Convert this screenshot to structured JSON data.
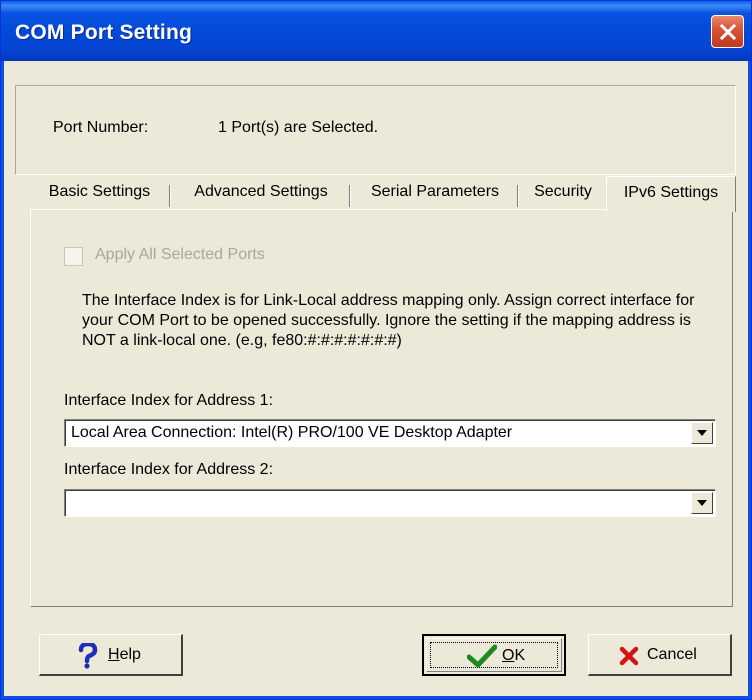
{
  "window": {
    "title": "COM Port Setting"
  },
  "port": {
    "label": "Port Number:",
    "value": "1 Port(s) are Selected."
  },
  "tabs": [
    {
      "label": "Basic Settings",
      "active": false
    },
    {
      "label": "Advanced Settings",
      "active": false
    },
    {
      "label": "Serial Parameters",
      "active": false
    },
    {
      "label": "Security",
      "active": false
    },
    {
      "label": "IPv6 Settings",
      "active": true
    }
  ],
  "ipv6": {
    "apply_all_label": "Apply All Selected Ports",
    "apply_all_checked": false,
    "apply_all_enabled": false,
    "info_text": "The Interface Index is for Link-Local address mapping only. Assign correct interface for your COM Port to be opened successfully. Ignore the setting if the mapping address is NOT a link-local one. (e.g, fe80:#:#:#:#:#:#:#)",
    "address1_label": "Interface Index for Address 1:",
    "address1_value": "Local Area Connection: Intel(R) PRO/100 VE Desktop Adapter",
    "address2_label": "Interface Index for Address 2:",
    "address2_value": ""
  },
  "buttons": {
    "help_label": "Help",
    "help_accel": "H",
    "help_rest": "elp",
    "ok_label": "OK",
    "ok_accel": "O",
    "ok_rest": "K",
    "cancel_label": "Cancel"
  },
  "colors": {
    "titlebar": "#0449d8",
    "close_button": "#d7563a",
    "window_bg": "#ece9d8",
    "disabled_text": "#aca899"
  },
  "icons": {
    "help": "question-mark-icon",
    "ok": "checkmark-icon",
    "cancel": "red-x-icon",
    "close": "close-icon",
    "dropdown": "chevron-down-icon"
  }
}
